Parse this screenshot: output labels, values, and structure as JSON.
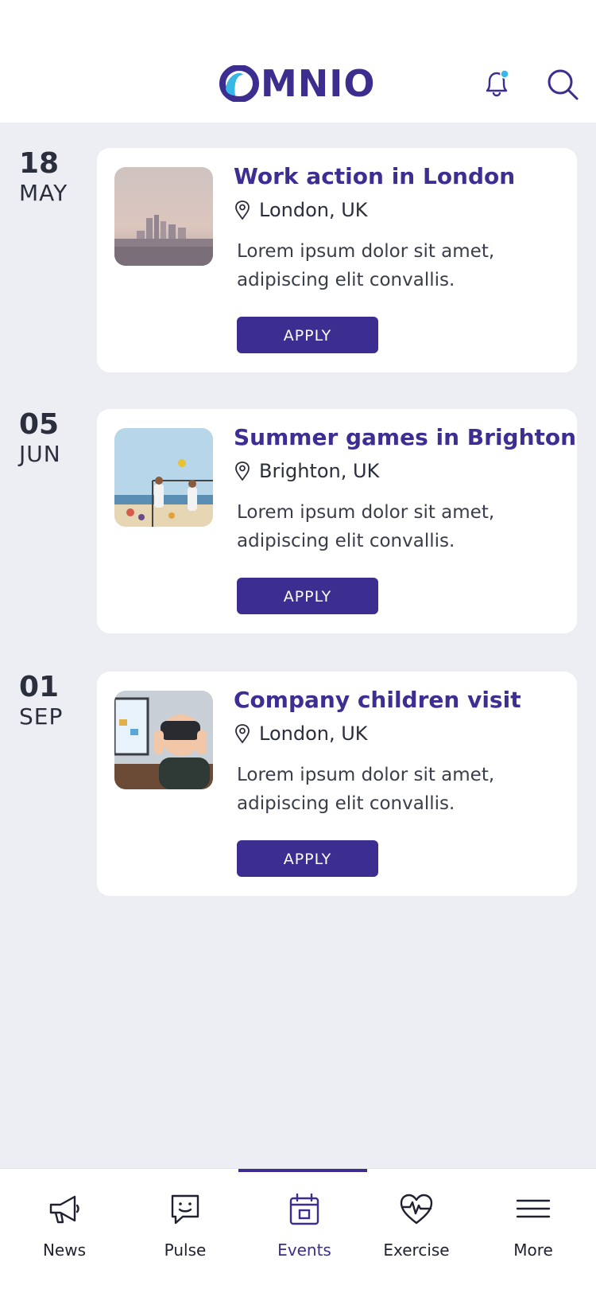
{
  "app": {
    "logo_text": "MNIO",
    "brand_color": "#3c2d91",
    "accent_color": "#36b7e6"
  },
  "header": {
    "icons": [
      "bell-icon",
      "search-icon"
    ]
  },
  "events": [
    {
      "day": "18",
      "month": "MAY",
      "title": "Work action in London",
      "location": "London, UK",
      "description": "Lorem ipsum dolor sit amet, adipiscing elit convallis.",
      "button_label": "APPLY"
    },
    {
      "day": "05",
      "month": "JUN",
      "title": "Summer games in Brighton",
      "location": "Brighton, UK",
      "description": "Lorem ipsum dolor sit amet, adipiscing elit convallis.",
      "button_label": "APPLY"
    },
    {
      "day": "01",
      "month": "SEP",
      "title": "Company children visit",
      "location": "London, UK",
      "description": "Lorem ipsum dolor sit amet, adipiscing elit convallis.",
      "button_label": "APPLY"
    }
  ],
  "tabbar": {
    "active": "Events",
    "items": [
      {
        "label": "News",
        "icon": "megaphone-icon"
      },
      {
        "label": "Pulse",
        "icon": "chat-smile-icon"
      },
      {
        "label": "Events",
        "icon": "calendar-icon"
      },
      {
        "label": "Exercise",
        "icon": "heartbeat-icon"
      },
      {
        "label": "More",
        "icon": "menu-icon"
      }
    ]
  }
}
